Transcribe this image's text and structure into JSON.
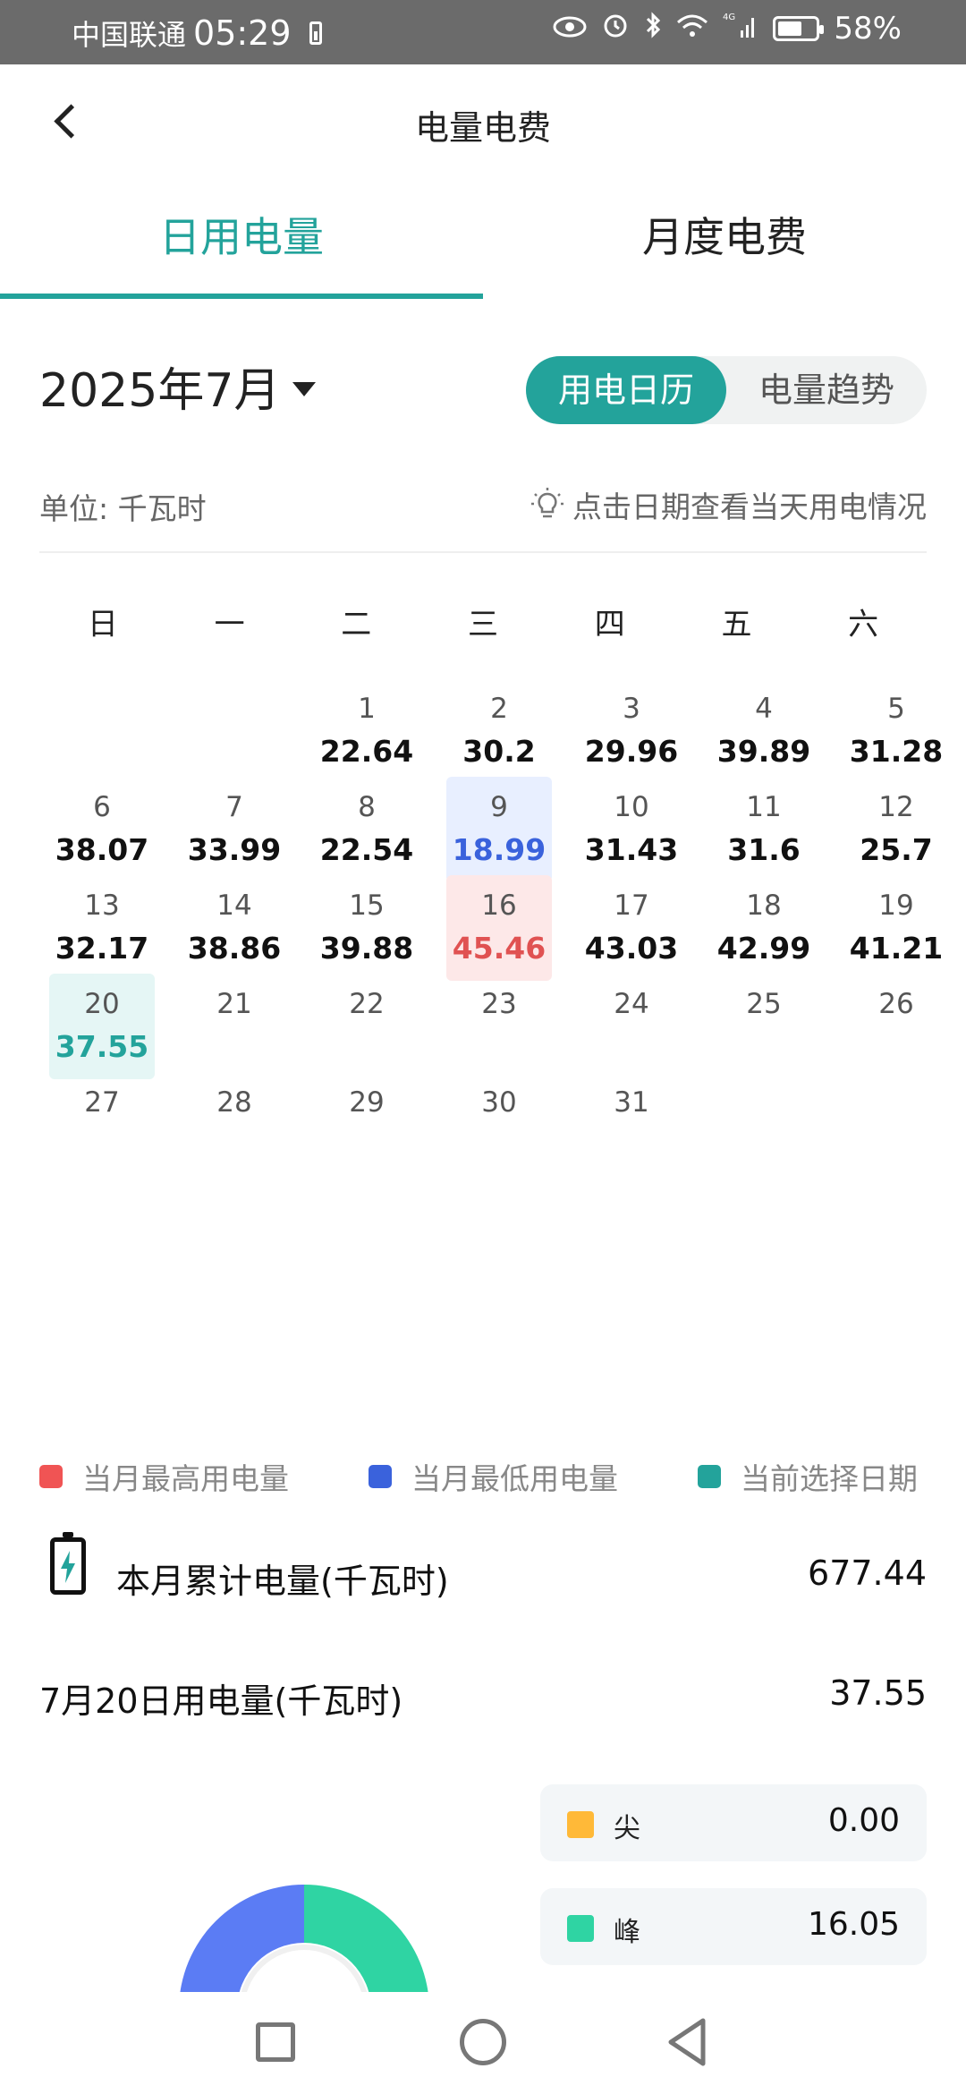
{
  "status_bar": {
    "carrier": "中国联通",
    "time": "05:29",
    "network": "4G",
    "battery": "58%"
  },
  "header": {
    "title": "电量电费"
  },
  "tabs": [
    {
      "label": "日用电量",
      "active": true
    },
    {
      "label": "月度电费",
      "active": false
    }
  ],
  "month_selector": {
    "label": "2025年7月"
  },
  "view_toggle": {
    "options": [
      "用电日历",
      "电量趋势"
    ],
    "selected": "用电日历"
  },
  "unit_label": "单位:  千瓦时",
  "hint": "点击日期查看当天用电情况",
  "weekdays": [
    "日",
    "一",
    "二",
    "三",
    "四",
    "五",
    "六"
  ],
  "calendar": {
    "first_weekday_index": 2,
    "days": [
      {
        "day": "1",
        "value": "22.64"
      },
      {
        "day": "2",
        "value": "30.2"
      },
      {
        "day": "3",
        "value": "29.96"
      },
      {
        "day": "4",
        "value": "39.89"
      },
      {
        "day": "5",
        "value": "31.28"
      },
      {
        "day": "6",
        "value": "38.07"
      },
      {
        "day": "7",
        "value": "33.99"
      },
      {
        "day": "8",
        "value": "22.54"
      },
      {
        "day": "9",
        "value": "18.99",
        "state": "low"
      },
      {
        "day": "10",
        "value": "31.43"
      },
      {
        "day": "11",
        "value": "31.6"
      },
      {
        "day": "12",
        "value": "25.7"
      },
      {
        "day": "13",
        "value": "32.17"
      },
      {
        "day": "14",
        "value": "38.86"
      },
      {
        "day": "15",
        "value": "39.88"
      },
      {
        "day": "16",
        "value": "45.46",
        "state": "high"
      },
      {
        "day": "17",
        "value": "43.03"
      },
      {
        "day": "18",
        "value": "42.99"
      },
      {
        "day": "19",
        "value": "41.21"
      },
      {
        "day": "20",
        "value": "37.55",
        "state": "selected"
      },
      {
        "day": "21",
        "value": ""
      },
      {
        "day": "22",
        "value": ""
      },
      {
        "day": "23",
        "value": ""
      },
      {
        "day": "24",
        "value": ""
      },
      {
        "day": "25",
        "value": ""
      },
      {
        "day": "26",
        "value": ""
      },
      {
        "day": "27",
        "value": ""
      },
      {
        "day": "28",
        "value": ""
      },
      {
        "day": "29",
        "value": ""
      },
      {
        "day": "30",
        "value": ""
      },
      {
        "day": "31",
        "value": ""
      }
    ]
  },
  "legend": [
    {
      "label": "当月最高用电量",
      "color": "#f05454"
    },
    {
      "label": "当月最低用电量",
      "color": "#3a62dc"
    },
    {
      "label": "当前选择日期",
      "color": "#23a39b"
    }
  ],
  "summary": {
    "monthly_label": "本月累计电量(千瓦时)",
    "monthly_value": "677.44",
    "daily_label": "7月20日用电量(千瓦时)",
    "daily_value": "37.55"
  },
  "periods": [
    {
      "name": "尖",
      "value": "0.00",
      "color": "#ffb938"
    },
    {
      "name": "峰",
      "value": "16.05",
      "color": "#2fd4a3"
    }
  ],
  "colors": {
    "accent": "#23a39b",
    "donut_blue": "#5b7cf4",
    "donut_green": "#2fd4a3"
  }
}
